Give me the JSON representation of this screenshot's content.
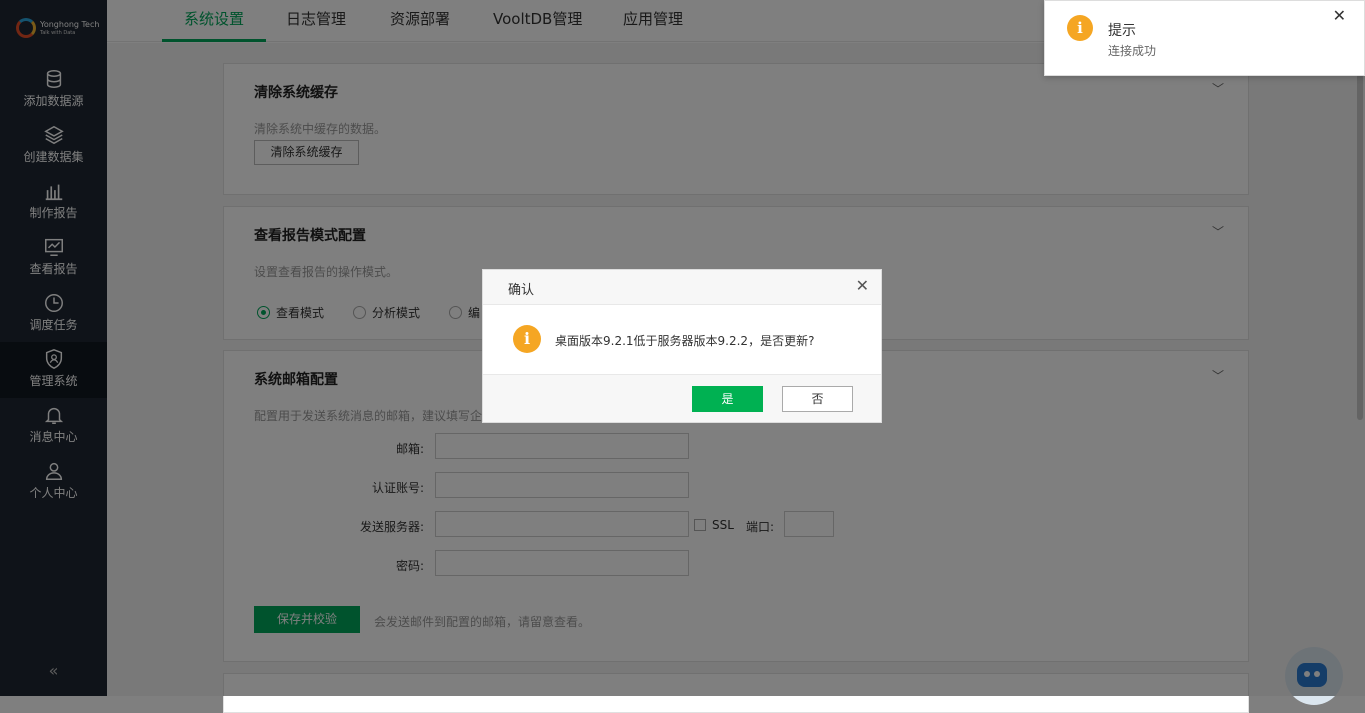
{
  "logo": {
    "brand": "Yonghong Tech",
    "tagline": "Talk with Data"
  },
  "sidebar": {
    "items": [
      {
        "label": "添加数据源",
        "icon": "database-icon"
      },
      {
        "label": "创建数据集",
        "icon": "layers-icon"
      },
      {
        "label": "制作报告",
        "icon": "bar-chart-icon"
      },
      {
        "label": "查看报告",
        "icon": "monitor-chart-icon"
      },
      {
        "label": "调度任务",
        "icon": "clock-icon"
      },
      {
        "label": "管理系统",
        "icon": "shield-user-icon",
        "active": true
      },
      {
        "label": "消息中心",
        "icon": "bell-icon"
      },
      {
        "label": "个人中心",
        "icon": "user-icon"
      }
    ],
    "collapse_label": "«"
  },
  "tabs": [
    {
      "label": "系统设置",
      "active": true
    },
    {
      "label": "日志管理"
    },
    {
      "label": "资源部署"
    },
    {
      "label": "VooltDB管理"
    },
    {
      "label": "应用管理"
    }
  ],
  "cards": {
    "clear_cache": {
      "title": "清除系统缓存",
      "desc": "清除系统中缓存的数据。",
      "button": "清除系统缓存"
    },
    "report_mode": {
      "title": "查看报告模式配置",
      "desc": "设置查看报告的操作模式。",
      "options": [
        "查看模式",
        "分析模式",
        "编"
      ]
    },
    "mail": {
      "title": "系统邮箱配置",
      "desc": "配置用于发送系统消息的邮箱，建议填写企",
      "labels": {
        "email": "邮箱:",
        "account": "认证账号:",
        "server": "发送服务器:",
        "password": "密码:",
        "ssl": "SSL",
        "port": "端口:"
      },
      "save_button": "保存并校验",
      "hint": "会发送邮件到配置的邮箱，请留意查看。"
    }
  },
  "toast": {
    "title": "提示",
    "message": "连接成功",
    "icon": "i"
  },
  "dialog": {
    "title": "确认",
    "icon": "i",
    "message": "桌面版本9.2.1低于服务器版本9.2.2，是否更新?",
    "yes": "是",
    "no": "否"
  },
  "colors": {
    "accent": "#00a65a",
    "sidebar_bg": "#1f2733",
    "warning": "#f5a623"
  }
}
